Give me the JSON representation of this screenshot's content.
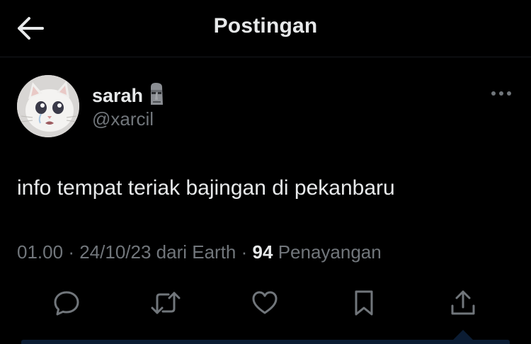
{
  "header": {
    "title": "Postingan",
    "back_icon": "arrow-left-icon"
  },
  "post": {
    "author": {
      "name": "sarah",
      "name_emoji": "🗿",
      "handle": "@xarcil",
      "avatar_icon": "crying-cat-avatar"
    },
    "more_icon": "more-horizontal-icon",
    "text": "info tempat teriak bajingan di pekanbaru",
    "meta": {
      "time": "01.00",
      "separator": "·",
      "date": "24/10/23",
      "source": "dari Earth",
      "views_count": "94",
      "views_label": "Penayangan"
    },
    "actions": [
      {
        "name": "reply",
        "icon": "reply-icon"
      },
      {
        "name": "repost",
        "icon": "repost-icon"
      },
      {
        "name": "like",
        "icon": "heart-icon"
      },
      {
        "name": "bookmark",
        "icon": "bookmark-icon"
      },
      {
        "name": "share",
        "icon": "share-icon"
      }
    ]
  },
  "colors": {
    "background": "#000000",
    "primary_text": "#e7e9ea",
    "secondary_text": "#71767b",
    "accent": "#1d9bf0"
  }
}
